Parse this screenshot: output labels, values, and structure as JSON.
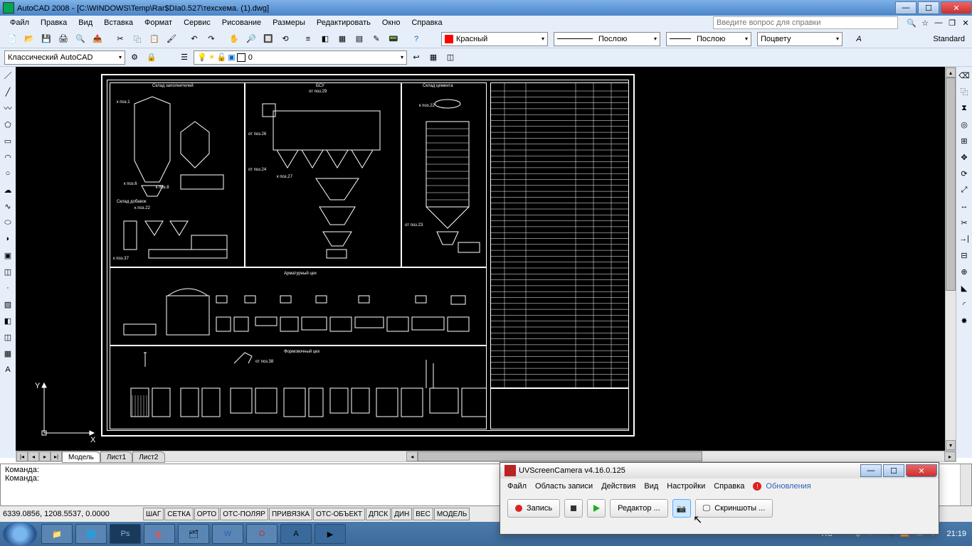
{
  "titlebar": {
    "app": "AutoCAD 2008",
    "doc": "[C:\\WINDOWS\\Temp\\Rar$DIa0.527\\техсхема. (1).dwg]"
  },
  "menu": {
    "file": "Файл",
    "edit": "Правка",
    "view": "Вид",
    "insert": "Вставка",
    "format": "Формат",
    "service": "Сервис",
    "draw": "Рисование",
    "dim": "Размеры",
    "modify": "Редактировать",
    "window": "Окно",
    "help": "Справка"
  },
  "search_placeholder": "Введите вопрос для справки",
  "workspace": "Классический AutoCAD",
  "layer_current": "0",
  "props": {
    "color": "Красный",
    "ltype": "Послою",
    "lweight": "Послою",
    "plotstyle": "Поцвету",
    "textstyle": "Standard"
  },
  "tabs": {
    "model": "Модель",
    "l1": "Лист1",
    "l2": "Лист2"
  },
  "cmd": {
    "line1": "Команда:",
    "line2": "Команда:"
  },
  "status": {
    "coords": "6339.0856, 1208.5537, 0.0000",
    "modes": [
      "ШАГ",
      "СЕТКА",
      "ОРТО",
      "ОТС-ПОЛЯР",
      "ПРИВЯЗКА",
      "ОТС-ОБЪЕКТ",
      "ДПСК",
      "ДИН",
      "ВЕС",
      "МОДЕЛЬ"
    ]
  },
  "drawing": {
    "labels": {
      "fill_store": "Склад заполнителей",
      "bsu": "БСУ",
      "cement_store": "Склад цемента",
      "add_store": "Склад добавок",
      "rebar": "Арматурный цех",
      "form": "Формовочный цех",
      "pos1": "к поз.1",
      "pos6": "к поз.6",
      "pos8": "к поз.8",
      "pos22": "к поз.22",
      "pos23": "от поз.23",
      "pos24": "от поз.24",
      "pos26": "от поз.26",
      "pos27": "к поз.27",
      "pos29": "от поз.29",
      "pos37": "к поз.37",
      "pos38": "от поз.38"
    }
  },
  "uv": {
    "title": "UVScreenCamera v4.16.0.125",
    "menu": {
      "file": "Файл",
      "area": "Область записи",
      "actions": "Действия",
      "view": "Вид",
      "settings": "Настройки",
      "help": "Справка",
      "updates": "Обновления"
    },
    "btns": {
      "record": "Запись",
      "editor": "Редактор ...",
      "shots": "Скриншоты ..."
    }
  },
  "tray": {
    "lang": "RU",
    "time": "21:19"
  }
}
